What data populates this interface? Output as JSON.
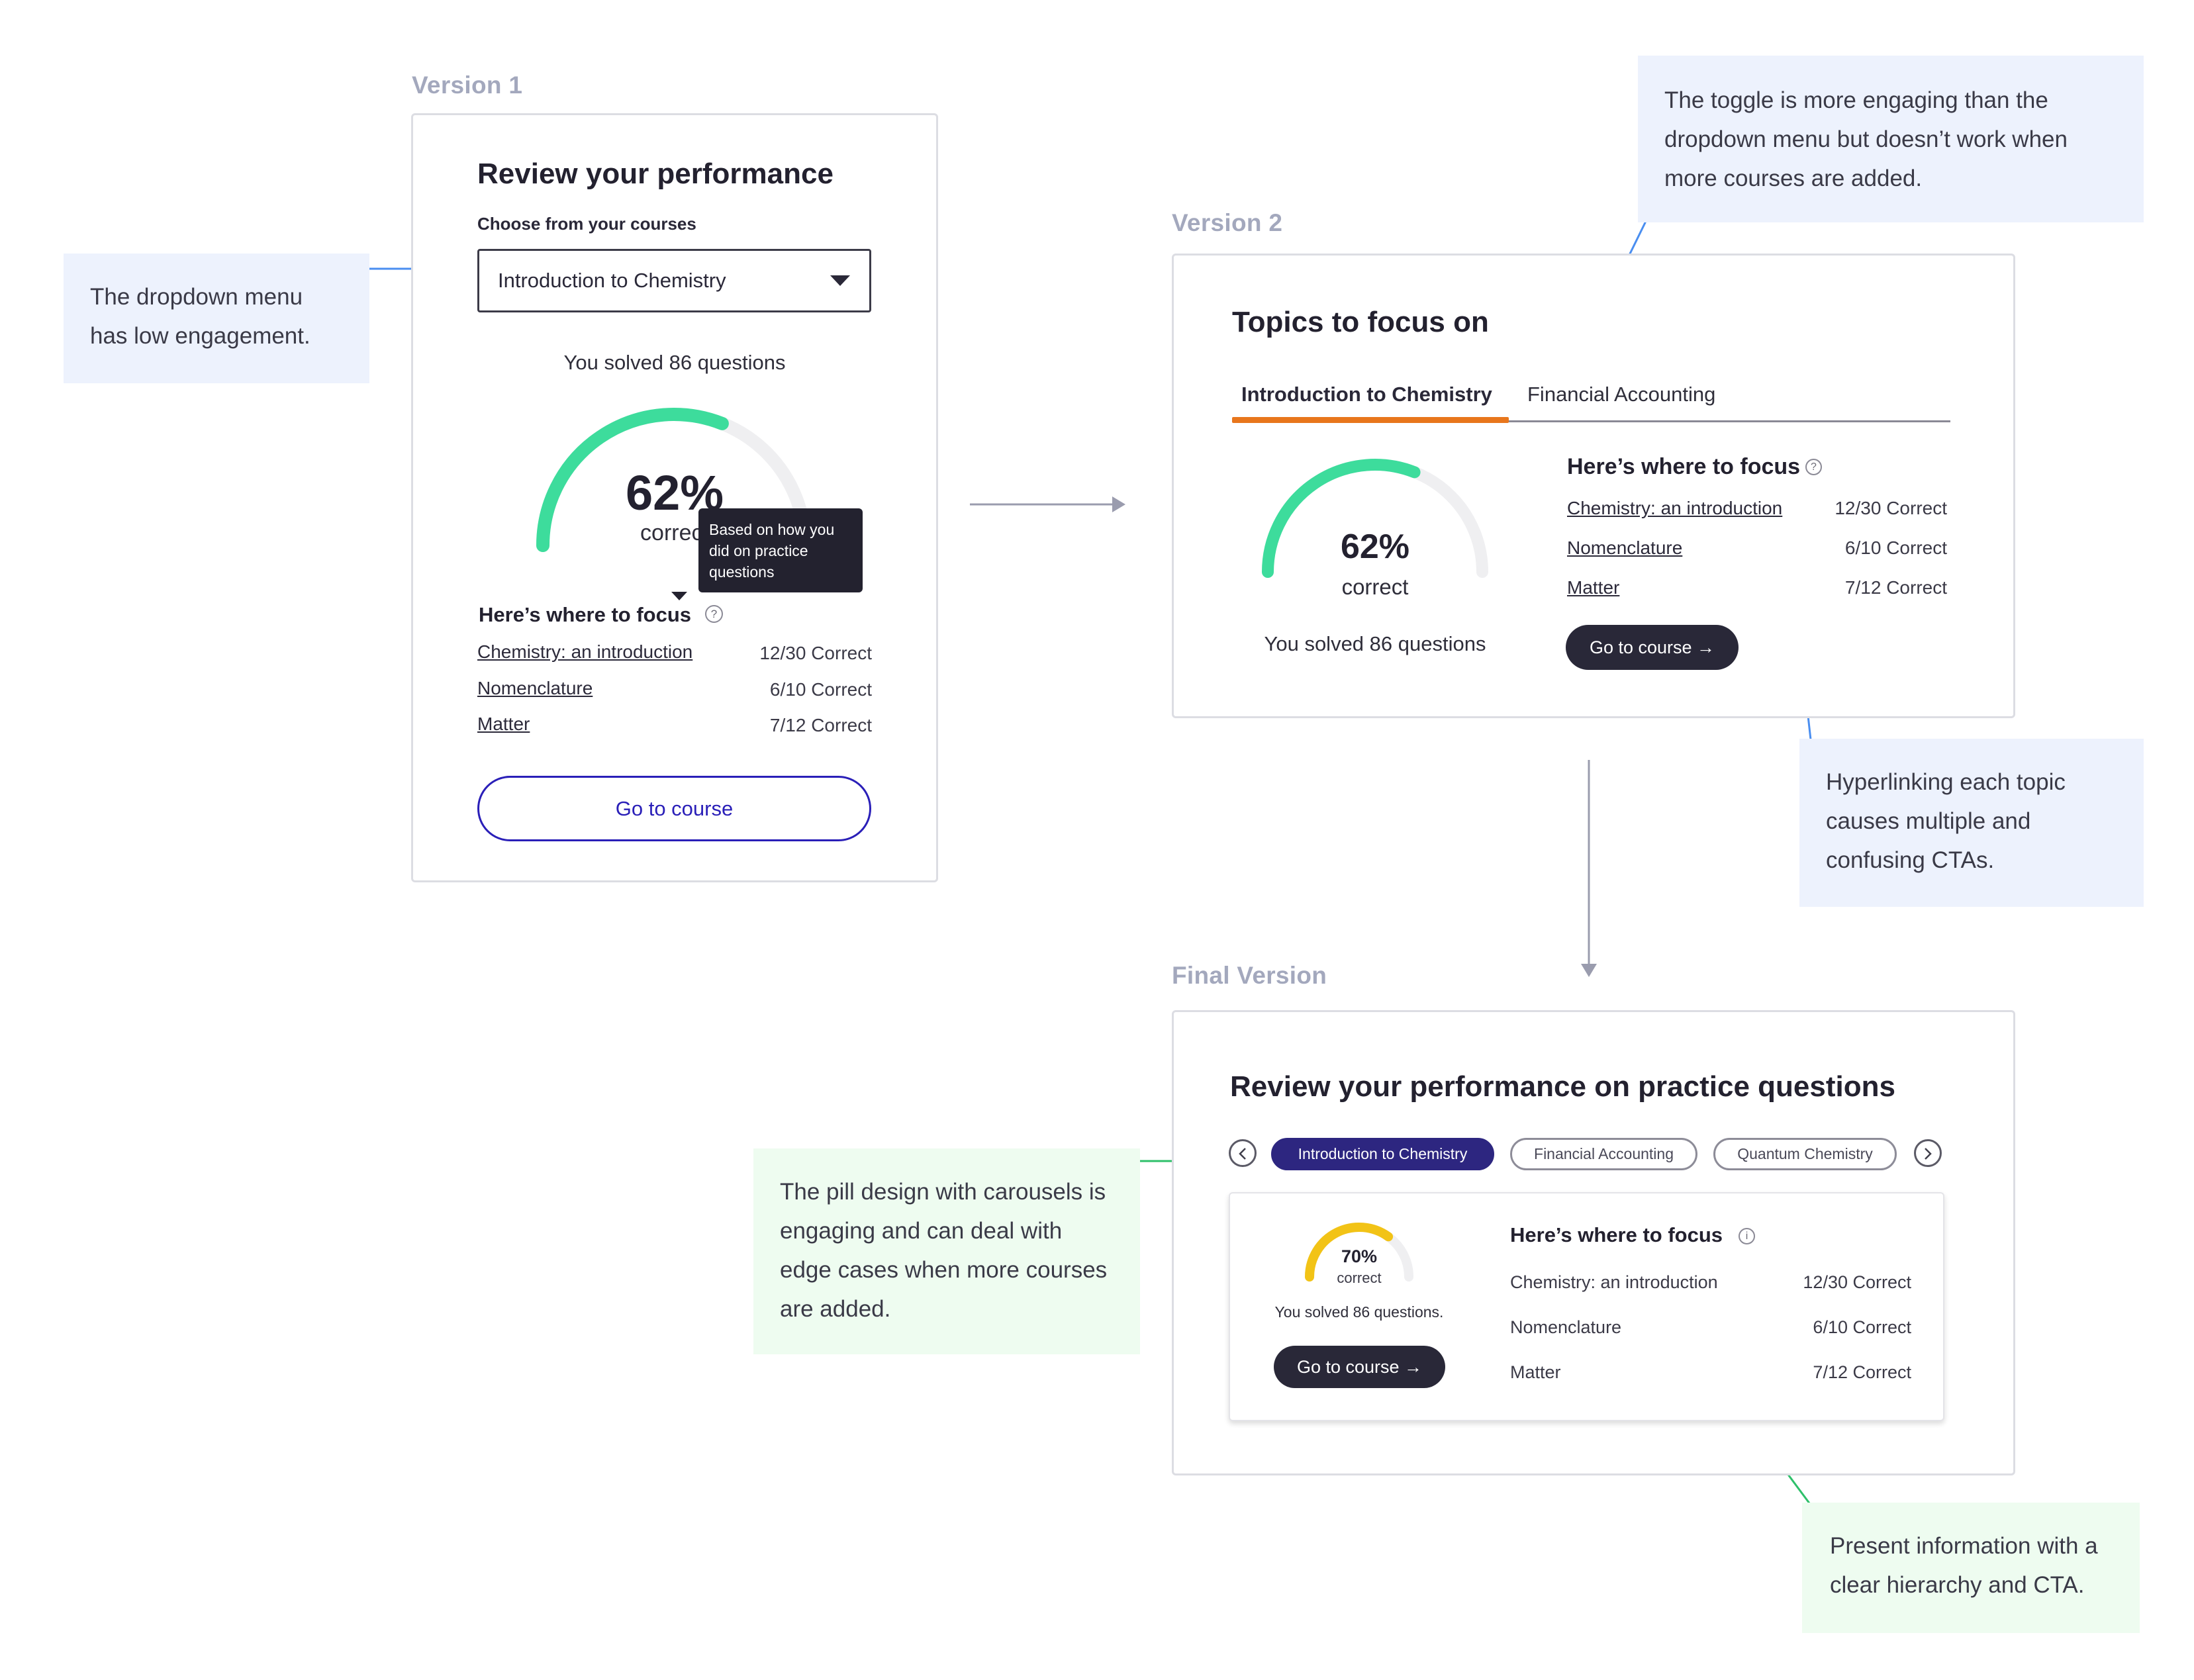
{
  "version1": {
    "label": "Version 1",
    "title": "Review your performance",
    "choose_label": "Choose from your courses",
    "dropdown_value": "Introduction to Chemistry",
    "solved": "You solved 86 questions",
    "percent": "62%",
    "percent_value": 62,
    "correct": "correct",
    "tooltip": "Based on how you did on practice questions",
    "focus_heading": "Here’s where to focus",
    "topics": [
      {
        "name": "Chemistry: an introduction",
        "score": "12/30 Correct"
      },
      {
        "name": "Nomenclature",
        "score": "6/10 Correct"
      },
      {
        "name": "Matter",
        "score": "7/12 Correct"
      }
    ],
    "cta": "Go to course",
    "note": "The dropdown menu has low engagement."
  },
  "version2": {
    "label": "Version 2",
    "title": "Topics to focus on",
    "tabs": [
      "Introduction to Chemistry",
      "Financial Accounting"
    ],
    "percent": "62%",
    "percent_value": 62,
    "correct": "correct",
    "solved": "You solved 86 questions",
    "focus_heading": "Here’s where to focus",
    "topics": [
      {
        "name": "Chemistry: an introduction",
        "score": "12/30 Correct"
      },
      {
        "name": "Nomenclature",
        "score": "6/10 Correct"
      },
      {
        "name": "Matter",
        "score": "7/12 Correct"
      }
    ],
    "cta": "Go to course →",
    "note_toggle": "The toggle is more engaging than the dropdown menu but doesn’t work when more courses are added.",
    "note_links": "Hyperlinking each topic causes multiple and confusing CTAs."
  },
  "final": {
    "label": "Final Version",
    "title": "Review your performance on practice questions",
    "pills": [
      "Introduction to Chemistry",
      "Financial Accounting",
      "Quantum Chemistry"
    ],
    "percent": "70%",
    "percent_value": 70,
    "correct": "correct",
    "solved": "You solved 86 questions.",
    "cta": "Go to course →",
    "focus_heading": "Here’s where to focus",
    "topics": [
      {
        "name": "Chemistry: an introduction",
        "score": "12/30 Correct"
      },
      {
        "name": "Nomenclature",
        "score": "6/10 Correct"
      },
      {
        "name": "Matter",
        "score": "7/12 Correct"
      }
    ],
    "note_pills": "The pill design with carousels is engaging and can deal with edge cases when more courses are added.",
    "note_hierarchy": "Present information with a clear hierarchy and CTA."
  },
  "colors": {
    "gauge_green": "#3ddc9c",
    "gauge_track": "#efeff1",
    "gauge_yellow": "#f2c316",
    "tab_underline": "#e8761c",
    "pill_active": "#2d2680",
    "dark_button": "#292838",
    "link_blue": "#2a1fb8",
    "connector_blue": "#4a8ef0",
    "connector_green": "#2ec06a"
  }
}
